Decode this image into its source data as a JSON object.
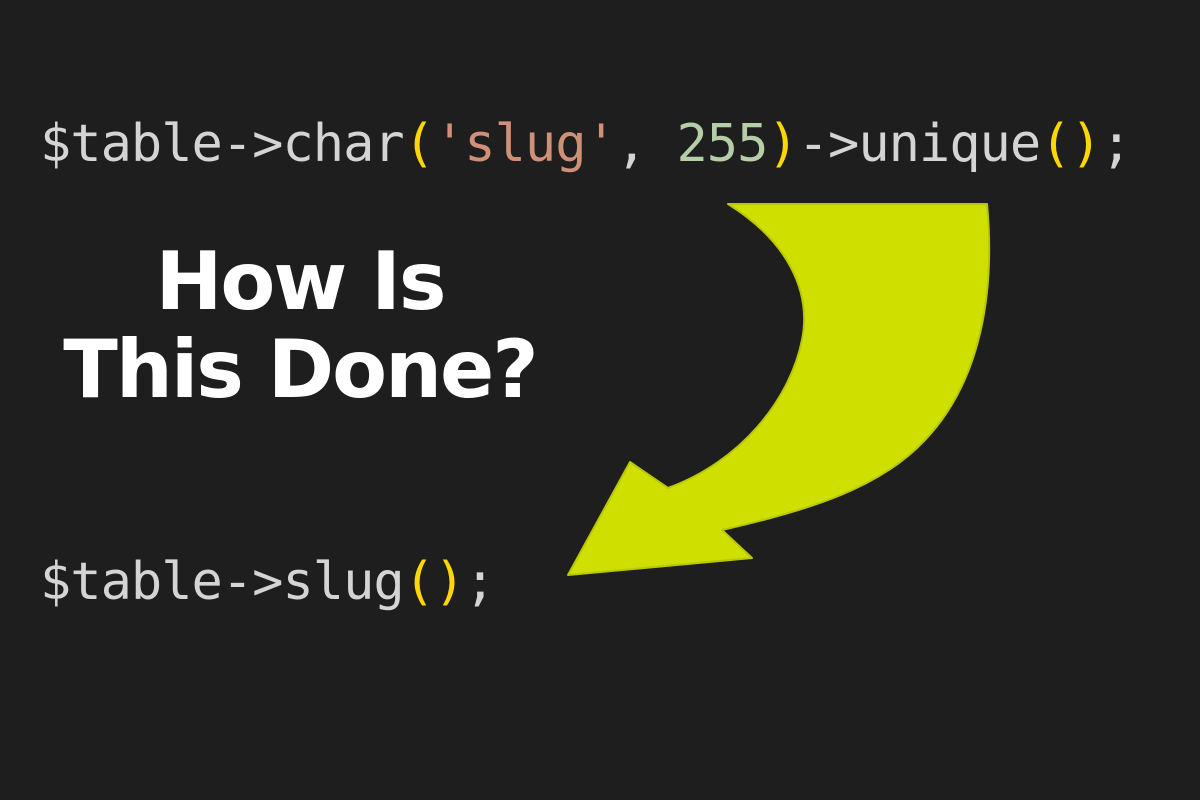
{
  "code_top": {
    "tokens": [
      {
        "text": "$table->char",
        "kind": "plain"
      },
      {
        "text": "(",
        "kind": "paren"
      },
      {
        "text": "'slug'",
        "kind": "string"
      },
      {
        "text": ", ",
        "kind": "plain"
      },
      {
        "text": "255",
        "kind": "number"
      },
      {
        "text": ")",
        "kind": "paren"
      },
      {
        "text": "->unique",
        "kind": "plain"
      },
      {
        "text": "()",
        "kind": "paren"
      },
      {
        "text": ";",
        "kind": "plain"
      }
    ]
  },
  "headline": {
    "line1": "How Is",
    "line2": "This Done?"
  },
  "code_bottom": {
    "tokens": [
      {
        "text": "$table->slug",
        "kind": "plain"
      },
      {
        "text": "()",
        "kind": "paren"
      },
      {
        "text": ";",
        "kind": "plain"
      }
    ]
  },
  "arrow": {
    "icon": "curved-arrow-icon",
    "color": "#cfe000"
  },
  "colors": {
    "background": "#1e1e1e",
    "code_plain": "#d4d4d4",
    "code_paren": "#ffd700",
    "code_string": "#ce9178",
    "code_number": "#b5cea8",
    "headline": "#ffffff"
  }
}
